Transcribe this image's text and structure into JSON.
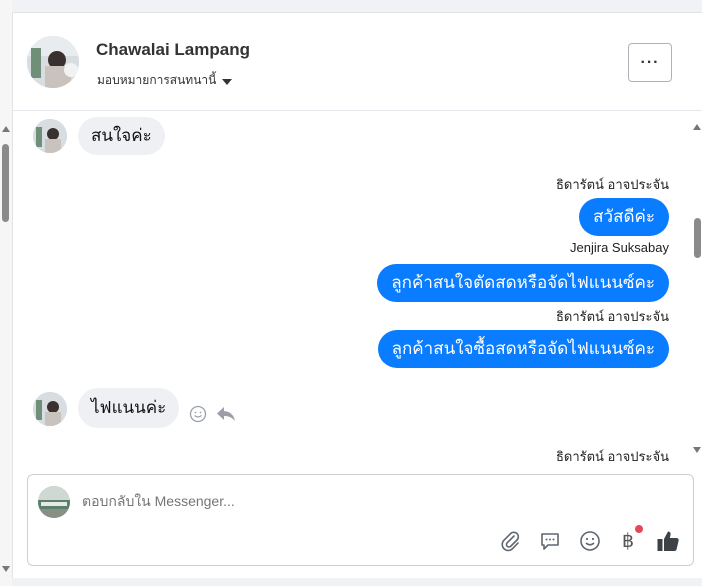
{
  "conversation": {
    "contact_name": "Chawalai Lampang",
    "assign_label": "มอบหมายการสนทนานี้",
    "more_label": "···"
  },
  "messages": [
    {
      "direction": "in",
      "text": "สนใจค่ะ"
    },
    {
      "direction": "out",
      "sender": "ธิดารัตน์ อาจประจัน",
      "text": "สวัสดีค่ะ"
    },
    {
      "direction": "out",
      "sender": "Jenjira Suksabay",
      "text": "ลูกค้าสนใจตัดสดหรือจัดไฟแนนซ์คะ"
    },
    {
      "direction": "out",
      "sender": "ธิดารัตน์ อาจประจัน",
      "text": "ลูกค้าสนใจซื้อสดหรือจัดไฟแนนซ์คะ"
    },
    {
      "direction": "in",
      "text": "ไฟแนนค่ะ"
    },
    {
      "direction": "out",
      "sender": "ธิดารัตน์ อาจประจัน",
      "text": ""
    }
  ],
  "composer": {
    "placeholder": "ตอบกลับใน Messenger...",
    "baht_symbol": "฿"
  },
  "colors": {
    "outgoing_bubble": "#0a7cff",
    "incoming_bubble": "#eef0f3",
    "notification_dot": "#e8465b"
  },
  "icons": [
    "more-icon",
    "caret-down-icon",
    "emoji-reaction-icon",
    "reply-icon",
    "attachment-icon",
    "saved-reply-icon",
    "emoji-icon",
    "payment-icon",
    "like-icon"
  ]
}
